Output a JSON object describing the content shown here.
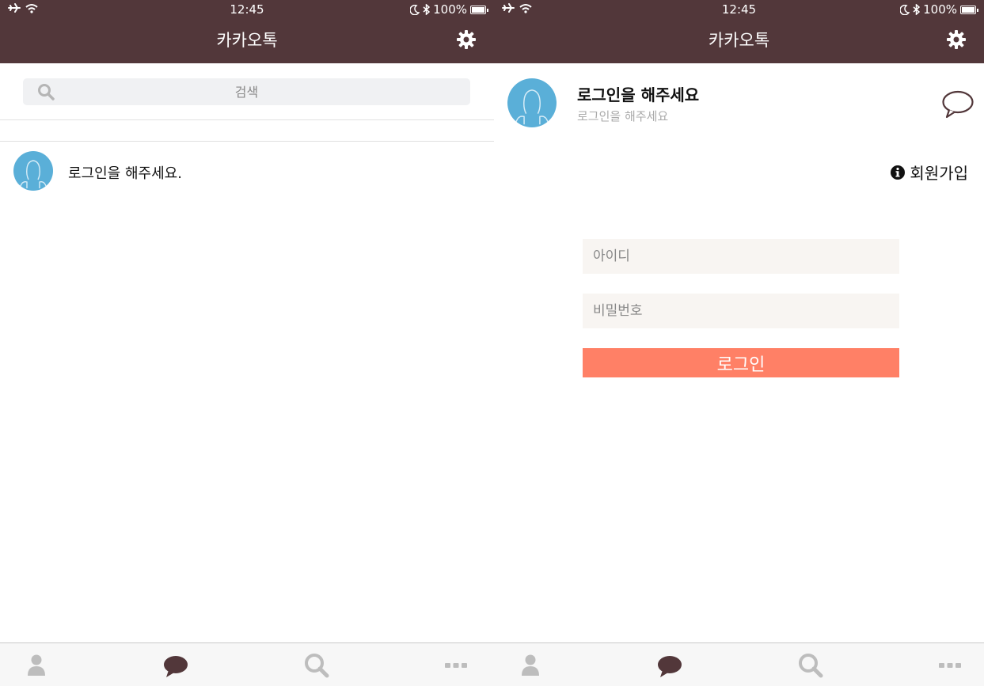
{
  "status_bar": {
    "time": "12:45",
    "battery": "100%"
  },
  "header": {
    "title": "카카오톡"
  },
  "friends_screen": {
    "search": {
      "placeholder": "검색"
    },
    "friends": [
      {
        "name": "로그인을 해주세요."
      }
    ]
  },
  "login_screen": {
    "profile": {
      "name": "로그인을 해주세요",
      "subtitle": "로그인을 해주세요"
    },
    "signup_label": "회원가입",
    "id_placeholder": "아이디",
    "password_placeholder": "비밀번호",
    "login_label": "로그인"
  },
  "tabs": [
    {
      "icon": "person-icon",
      "active": false
    },
    {
      "icon": "chat-bubble-icon",
      "active": true
    },
    {
      "icon": "search-icon",
      "active": false
    },
    {
      "icon": "more-icon",
      "active": false
    }
  ],
  "colors": {
    "header_bg": "#52373a",
    "avatar_bg": "#5aafd8",
    "login_button": "#ff8066",
    "input_bg": "#f8f5f2",
    "tab_active": "#52373a",
    "tab_inactive": "#bdbdbd"
  }
}
